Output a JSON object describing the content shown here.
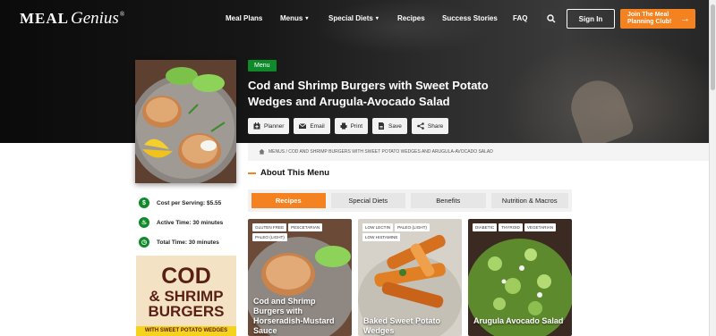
{
  "brand": {
    "logo_main": "MEAL",
    "logo_script": "Genius",
    "logo_mark": "®"
  },
  "nav": {
    "items": [
      "Meal Plans",
      "Menus",
      "Special Diets",
      "Recipes",
      "Success Stories",
      "FAQ"
    ],
    "search_icon": "search-icon",
    "signin_label": "Sign In",
    "join_label_1": "Join The Meal",
    "join_label_2": "Planning Club!"
  },
  "recipe": {
    "badge": "Menu",
    "title": "Cod and Shrimp Burgers with Sweet Potato Wedges and Arugula-Avocado Salad",
    "actions": [
      "Planner",
      "Email",
      "Print",
      "Save",
      "Share"
    ],
    "breadcrumb": "MENUS / COD AND SHRIMP BURGERS WITH SWEET POTATO WEDGES AND ARUGULA-AVOCADO SALAD"
  },
  "about": {
    "heading": "About This Menu",
    "tabs": [
      "Recipes",
      "Special Diets",
      "Benefits",
      "Nutrition & Macros"
    ],
    "active_tab": "Recipes"
  },
  "info": {
    "cost": "Cost per Serving: $5.55",
    "active": "Active Time: 30 minutes",
    "total": "Total Time: 30 minutes"
  },
  "promo": {
    "line1": "COD",
    "line2": "& SHRIMP",
    "line3": "BURGERS",
    "line4": "WITH SWEET POTATO WEDGES"
  },
  "cards": [
    {
      "tags": [
        "GLUTEN FREE",
        "PESCETARIAN",
        "PALEO (LIGHT)"
      ],
      "title": "Cod and Shrimp Burgers with Horseradish-Mustard Sauce"
    },
    {
      "tags": [
        "LOW LECTIN",
        "PALEO (LIGHT)",
        "LOW HISTAMINE"
      ],
      "title": "Baked Sweet Potato Wedges"
    },
    {
      "tags": [
        "DIABETIC",
        "THYROID",
        "VEGETARIAN"
      ],
      "title": "Arugula Avocado Salad"
    }
  ],
  "colors": {
    "accent": "#f58220",
    "badge_green": "#0f8a2a",
    "hero_dark": "#111111"
  }
}
